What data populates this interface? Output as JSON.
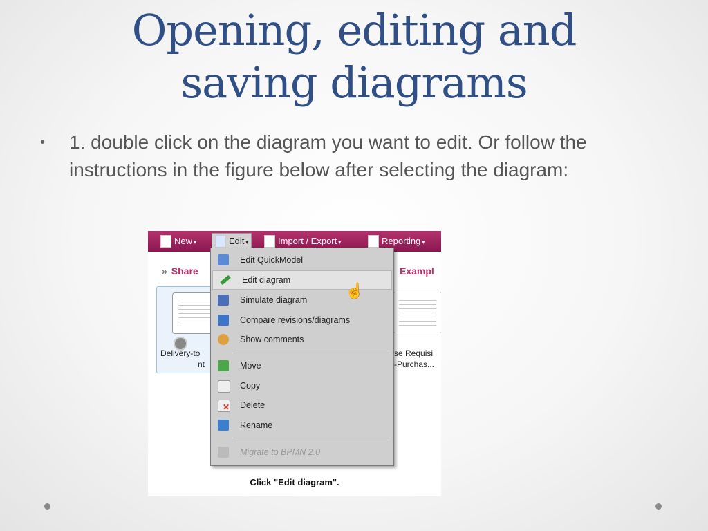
{
  "slide": {
    "title_line1": "Opening, editing and",
    "title_line2": "saving diagrams",
    "bullet_marker": "•",
    "bullet_text": "1. double click on the diagram you want to edit. Or follow the instructions in the figure below after selecting the diagram:"
  },
  "figure": {
    "toolbar": {
      "new": "New",
      "edit": "Edit",
      "import_export": "Import / Export",
      "reporting": "Reporting",
      "caret": "▾"
    },
    "breadcrumb_left": "Share",
    "breadcrumb_arrows": "»",
    "breadcrumb_right": "Exampl",
    "thumb_left_label_1": "Delivery-to",
    "thumb_left_label_2": "nt",
    "thumb_right_label_1": "se Requisi",
    "thumb_right_label_2": "-Purchas...",
    "menu": {
      "items": [
        {
          "label": "Edit QuickModel",
          "icon": "grid-icon",
          "color": "#5a8bd6"
        },
        {
          "label": "Edit diagram",
          "icon": "pencil-icon",
          "color": "#3a9a3a"
        },
        {
          "label": "Simulate diagram",
          "icon": "simulate-icon",
          "color": "#4a6fb8"
        },
        {
          "label": "Compare revisions/diagrams",
          "icon": "compare-icon",
          "color": "#3d74c9"
        },
        {
          "label": "Show comments",
          "icon": "comment-icon",
          "color": "#e0a040"
        },
        {
          "label": "Move",
          "icon": "move-icon",
          "color": "#4aa84a"
        },
        {
          "label": "Copy",
          "icon": "copy-icon",
          "color": "#eeeeee"
        },
        {
          "label": "Delete",
          "icon": "delete-icon",
          "color": "#d9352a"
        },
        {
          "label": "Rename",
          "icon": "rename-icon",
          "color": "#3b7fd0"
        },
        {
          "label": "Migrate to BPMN 2.0",
          "icon": "migrate-icon",
          "color": "#bbbbbb"
        }
      ]
    },
    "caption": "Click \"Edit diagram\"."
  },
  "colors": {
    "title": "#2f4f86",
    "toolbar": "#a0255e",
    "accent": "#b8306b"
  }
}
